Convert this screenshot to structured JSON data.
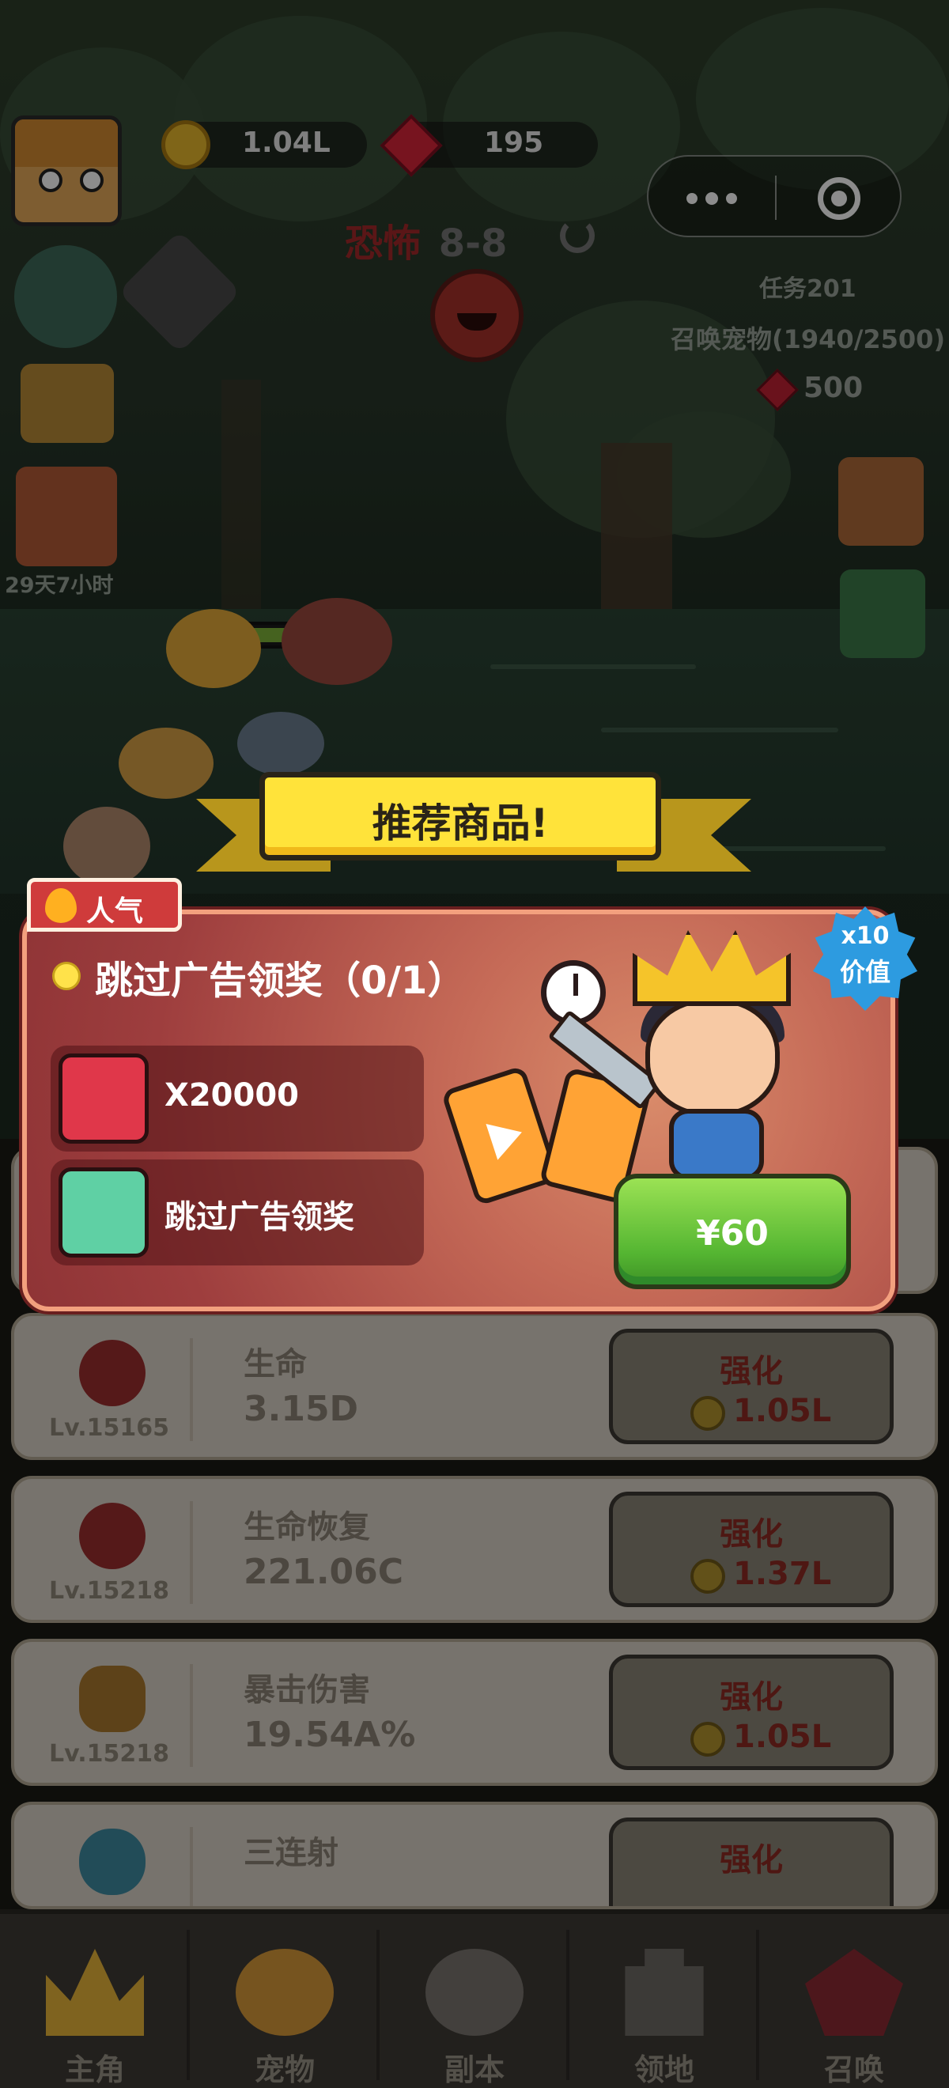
{
  "hud": {
    "coins": "1.04L",
    "gems": "195"
  },
  "stage": {
    "difficulty": "恐怖",
    "level": "8-8"
  },
  "quest": {
    "title": "任务201",
    "description": "召唤宠物(1940/2500)",
    "reward": "500"
  },
  "event": {
    "timer": "29天7小时"
  },
  "popup": {
    "banner": "推荐商品!",
    "tag": "人气",
    "title": "跳过广告领奖（0/1）",
    "rewards": [
      {
        "icon": "red-gem-icon",
        "text": "X20000"
      },
      {
        "icon": "no-ads-icon",
        "text": "跳过广告领奖"
      }
    ],
    "badge_top": "x10",
    "badge_bottom": "价值",
    "price": "¥60"
  },
  "upgrades": [
    {
      "icon": "heart-icon",
      "level": "Lv.15165",
      "name": "生命",
      "value": "3.15D",
      "button": "强化",
      "cost": "1.05L"
    },
    {
      "icon": "heart-regen-icon",
      "level": "Lv.15218",
      "name": "生命恢复",
      "value": "221.06C",
      "button": "强化",
      "cost": "1.37L"
    },
    {
      "icon": "crit-damage-icon",
      "level": "Lv.15218",
      "name": "暴击伤害",
      "value": "19.54A%",
      "button": "强化",
      "cost": "1.05L"
    },
    {
      "icon": "triple-shot-icon",
      "level": "",
      "name": "三连射",
      "value": "",
      "button": "强化",
      "cost": ""
    }
  ],
  "tabs": [
    {
      "label": "主角",
      "icon": "crown-icon"
    },
    {
      "label": "宠物",
      "icon": "cat-icon"
    },
    {
      "label": "副本",
      "icon": "crossed-swords-icon"
    },
    {
      "label": "领地",
      "icon": "castle-icon"
    },
    {
      "label": "召唤",
      "icon": "gem-summon-icon"
    }
  ],
  "colors": {
    "popup_bg": "#9e3e3e",
    "banner_yellow": "#ffe33a",
    "buy_green": "#55b632",
    "hot_red": "#cf3b3b",
    "value_badge_blue": "#2d9be0"
  }
}
